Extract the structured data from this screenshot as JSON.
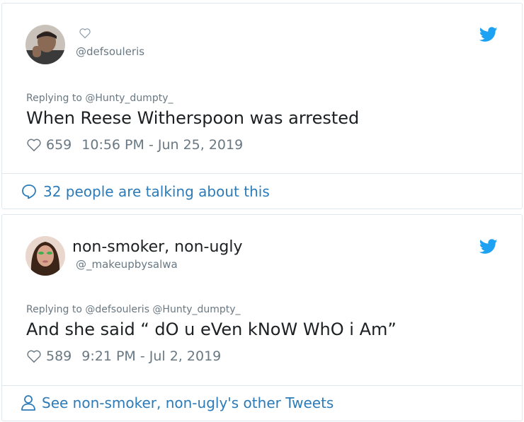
{
  "tweet1": {
    "handle": "@defsouleris",
    "reply": "Replying to @Hunty_dumpty_",
    "text": "When Reese Witherspoon was arrested",
    "likes": "659",
    "timestamp": "10:56 PM - Jun 25, 2019",
    "footer": "32 people are talking about this"
  },
  "tweet2": {
    "display_name": "non-smoker, non-ugly",
    "handle": "@_makeupbysalwa",
    "reply": "Replying to @defsouleris @Hunty_dumpty_",
    "text": "And she said “ dO u eVen kNoW WhO i Am”",
    "likes": "589",
    "timestamp": "9:21 PM - Jul 2, 2019",
    "footer": "See non-smoker, non-ugly's other Tweets"
  },
  "icons": {
    "bird": "twitter-bird-icon",
    "heart": "heart-icon",
    "comment": "speech-bubble-icon",
    "person": "person-icon"
  },
  "colors": {
    "twitter_blue": "#1da1f2",
    "link_blue": "#2b7bb9",
    "muted": "#697882",
    "text": "#1c2022",
    "border": "#e1e8ed"
  }
}
